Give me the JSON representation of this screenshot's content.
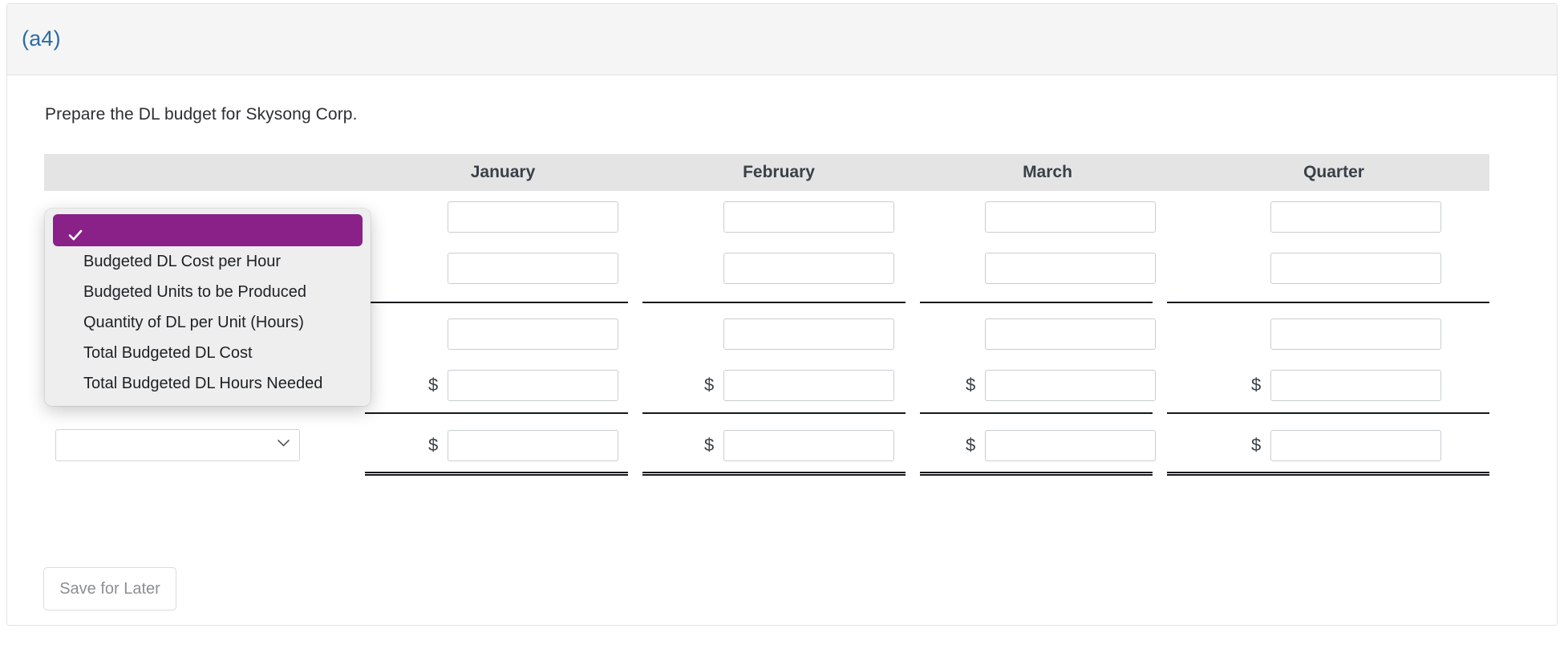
{
  "header": {
    "part_label": "(a4)"
  },
  "prompt": {
    "text": "Prepare the DL budget for Skysong Corp."
  },
  "table": {
    "columns": [
      {
        "key": "label",
        "label": ""
      },
      {
        "key": "january",
        "label": "January"
      },
      {
        "key": "february",
        "label": "February"
      },
      {
        "key": "march",
        "label": "March"
      },
      {
        "key": "quarter",
        "label": "Quarter"
      }
    ],
    "rows": [
      {
        "label_value": "",
        "currency": false,
        "january": "",
        "february": "",
        "march": "",
        "quarter": "",
        "rule_after": "none"
      },
      {
        "label_value": "",
        "currency": false,
        "january": "",
        "february": "",
        "march": "",
        "quarter": "",
        "rule_after": "single"
      },
      {
        "label_value": "",
        "currency": false,
        "january": "",
        "february": "",
        "march": "",
        "quarter": "",
        "rule_after": "none"
      },
      {
        "label_value": "",
        "currency": true,
        "january": "",
        "february": "",
        "march": "",
        "quarter": "",
        "rule_after": "single"
      },
      {
        "label_value": "",
        "currency": true,
        "january": "",
        "february": "",
        "march": "",
        "quarter": "",
        "rule_after": "double"
      }
    ],
    "currency_symbol": "$"
  },
  "dropdown": {
    "open": true,
    "selected_value": "",
    "options": [
      "",
      "Budgeted DL Cost per Hour",
      "Budgeted Units to be Produced",
      "Quantity of DL per Unit (Hours)",
      "Total Budgeted DL Cost",
      "Total Budgeted DL Hours Needed"
    ]
  },
  "footer": {
    "save_label": "Save for Later"
  },
  "colors": {
    "accent_blue": "#2a6ca8",
    "highlight_purple": "#8a2189",
    "header_bg": "#f5f5f5",
    "table_header_bg": "#e4e4e4",
    "rule": "#15181b"
  }
}
